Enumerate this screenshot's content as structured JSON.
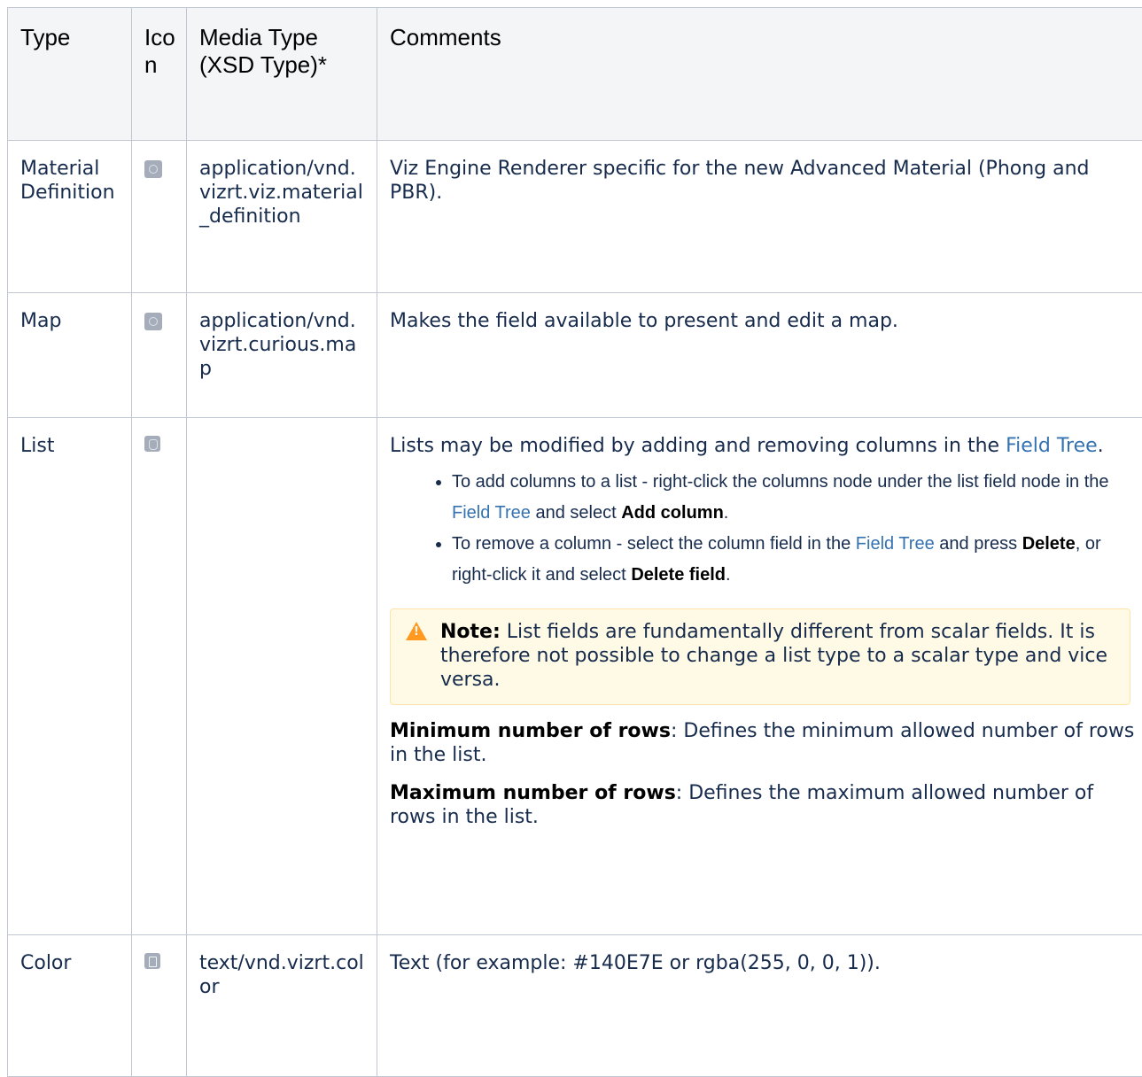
{
  "table": {
    "headers": {
      "type": "Type",
      "icon": "Icon",
      "media_type": "Media Type (XSD Type)*",
      "comments": "Comments"
    },
    "rows": [
      {
        "type": "Material Definition",
        "icon": "material-icon",
        "media_type": "application/vnd.vizrt.viz.material_definition",
        "comments": "Viz Engine Renderer specific for the new Advanced Material (Phong and PBR)."
      },
      {
        "type": "Map",
        "icon": "globe-icon",
        "media_type": "application/vnd.vizrt.curious.map",
        "comments": "Makes the field available to present and edit a map."
      },
      {
        "type": "List",
        "icon": "database-icon",
        "media_type": "",
        "comments_intro": "Lists may be modified by adding and removing columns in the",
        "comments_link": "Field Tree",
        "comments_intro_end": ".",
        "bullets": [
          {
            "pre": "To add columns to a list -  right-click the columns node under the list field node in the",
            "link": "Field Tree",
            "mid": "and select",
            "bold": "Add column",
            "end": "."
          },
          {
            "pre": "To remove a column - select the column field in the",
            "link": "Field Tree",
            "mid": "and press",
            "bold": "Delete",
            "mid2": ", or right-click it and select",
            "bold2": "Delete field",
            "end": "."
          }
        ],
        "note": {
          "label": "Note:",
          "text": "List fields are fundamentally different from scalar fields. It is therefore not possible to change a list type to a scalar type and vice versa."
        },
        "min_rows": {
          "label": "Minimum number of rows",
          "text": ": Defines the minimum allowed number of rows in the list."
        },
        "max_rows": {
          "label": "Maximum number of rows",
          "text": ": Defines the maximum allowed number of rows in the list."
        }
      },
      {
        "type": "Color",
        "icon": "document-icon",
        "media_type": "text/vnd.vizrt.color",
        "comments": "Text (for example: #140E7E or rgba(255, 0, 0, 1))."
      }
    ]
  }
}
